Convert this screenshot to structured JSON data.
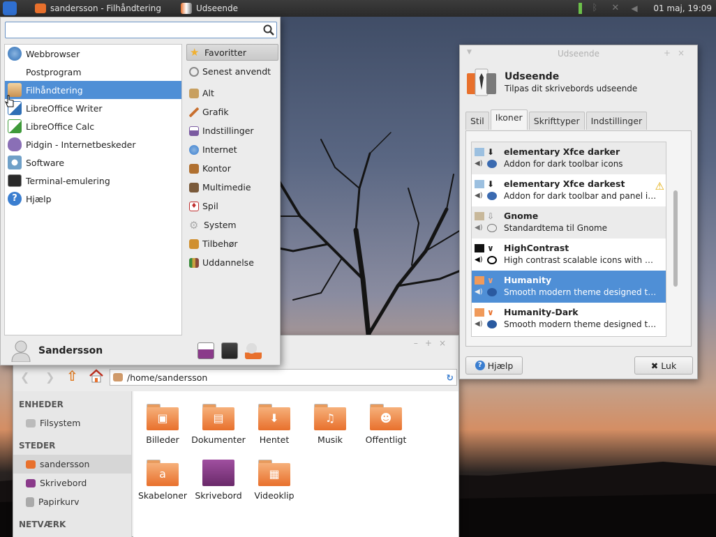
{
  "panel": {
    "tasks": [
      {
        "label": "sandersson - Filhåndtering",
        "icon": "home-folder-icon"
      },
      {
        "label": "Udseende",
        "icon": "appearance-icon"
      }
    ],
    "clock": "01 maj, 19:09"
  },
  "menu": {
    "search": {
      "value": "",
      "placeholder": ""
    },
    "apps": [
      {
        "label": "Webbrowser",
        "icon": "web-browser-icon",
        "color": "#2f6fb6"
      },
      {
        "label": "Postprogram",
        "icon": "mail-icon",
        "color": ""
      },
      {
        "label": "Filhåndtering",
        "icon": "file-manager-icon",
        "color": "#e8a85a"
      },
      {
        "label": "LibreOffice Writer",
        "icon": "writer-icon",
        "color": "#2f6fb6"
      },
      {
        "label": "LibreOffice Calc",
        "icon": "calc-icon",
        "color": "#3f9a3a"
      },
      {
        "label": "Pidgin - Internetbeskeder",
        "icon": "pidgin-icon",
        "color": "#8a6fb6"
      },
      {
        "label": "Software",
        "icon": "software-icon",
        "color": "#6fa0c8"
      },
      {
        "label": "Terminal-emulering",
        "icon": "terminal-icon",
        "color": "#2a2a2a"
      },
      {
        "label": "Hjælp",
        "icon": "help-icon",
        "color": "#3a7ed0"
      }
    ],
    "categories": [
      {
        "label": "Favoritter",
        "icon": "star-icon",
        "color": "#f0b030"
      },
      {
        "label": "Senest anvendt",
        "icon": "recent-icon",
        "color": "#888"
      },
      {
        "label": "Alt",
        "icon": "all-icon",
        "color": "#c8a060"
      },
      {
        "label": "Grafik",
        "icon": "graphics-icon",
        "color": "#c87030"
      },
      {
        "label": "Indstillinger",
        "icon": "settings-icon",
        "color": "#7a5aa0"
      },
      {
        "label": "Internet",
        "icon": "internet-icon",
        "color": "#3a7ed0"
      },
      {
        "label": "Kontor",
        "icon": "office-icon",
        "color": "#b07030"
      },
      {
        "label": "Multimedie",
        "icon": "multimedia-icon",
        "color": "#7a5a3a"
      },
      {
        "label": "Spil",
        "icon": "games-icon",
        "color": "#c03030"
      },
      {
        "label": "System",
        "icon": "system-icon",
        "color": "#aaa"
      },
      {
        "label": "Tilbehør",
        "icon": "accessories-icon",
        "color": "#d09030"
      },
      {
        "label": "Uddannelse",
        "icon": "education-icon",
        "color": "#8a6a3a"
      }
    ],
    "user": "Sandersson"
  },
  "thunar": {
    "location": "/home/sandersson",
    "sidebar": {
      "devices_header": "ENHEDER",
      "devices": [
        {
          "label": "Filsystem",
          "icon": "drive-icon"
        }
      ],
      "places_header": "STEDER",
      "places": [
        {
          "label": "sandersson",
          "icon": "home-icon"
        },
        {
          "label": "Skrivebord",
          "icon": "desktop-icon"
        },
        {
          "label": "Papirkurv",
          "icon": "trash-icon"
        }
      ],
      "network_header": "NETVÆRK"
    },
    "files": [
      {
        "label": "Billeder",
        "glyph": "▣"
      },
      {
        "label": "Dokumenter",
        "glyph": "▤"
      },
      {
        "label": "Hentet",
        "glyph": "⬇"
      },
      {
        "label": "Musik",
        "glyph": "♫"
      },
      {
        "label": "Offentligt",
        "glyph": "☻"
      },
      {
        "label": "Skabeloner",
        "glyph": "a"
      },
      {
        "label": "Skrivebord",
        "glyph": ""
      },
      {
        "label": "Videoklip",
        "glyph": "▦"
      }
    ]
  },
  "appearance": {
    "window_title": "Udseende",
    "title": "Udseende",
    "subtitle": "Tilpas dit skrivebords udseende",
    "tabs": [
      "Stil",
      "Ikoner",
      "Skrifttyper",
      "Indstillinger"
    ],
    "selected_tab": 1,
    "themes": [
      {
        "name": "elementary Xfce darker",
        "desc": "Addon for dark toolbar icons",
        "warning": false
      },
      {
        "name": "elementary Xfce darkest",
        "desc": "Addon for dark toolbar and panel ic...",
        "warning": true
      },
      {
        "name": "Gnome",
        "desc": "Standardtema til Gnome",
        "warning": false
      },
      {
        "name": "HighContrast",
        "desc": "High contrast scalable icons with black...",
        "warning": false
      },
      {
        "name": "Humanity",
        "desc": "Smooth modern theme designed to be...",
        "warning": false
      },
      {
        "name": "Humanity-Dark",
        "desc": "Smooth modern theme designed to be...",
        "warning": false
      }
    ],
    "selected_theme": 4,
    "help_label": "Hjælp",
    "close_label": "Luk"
  }
}
